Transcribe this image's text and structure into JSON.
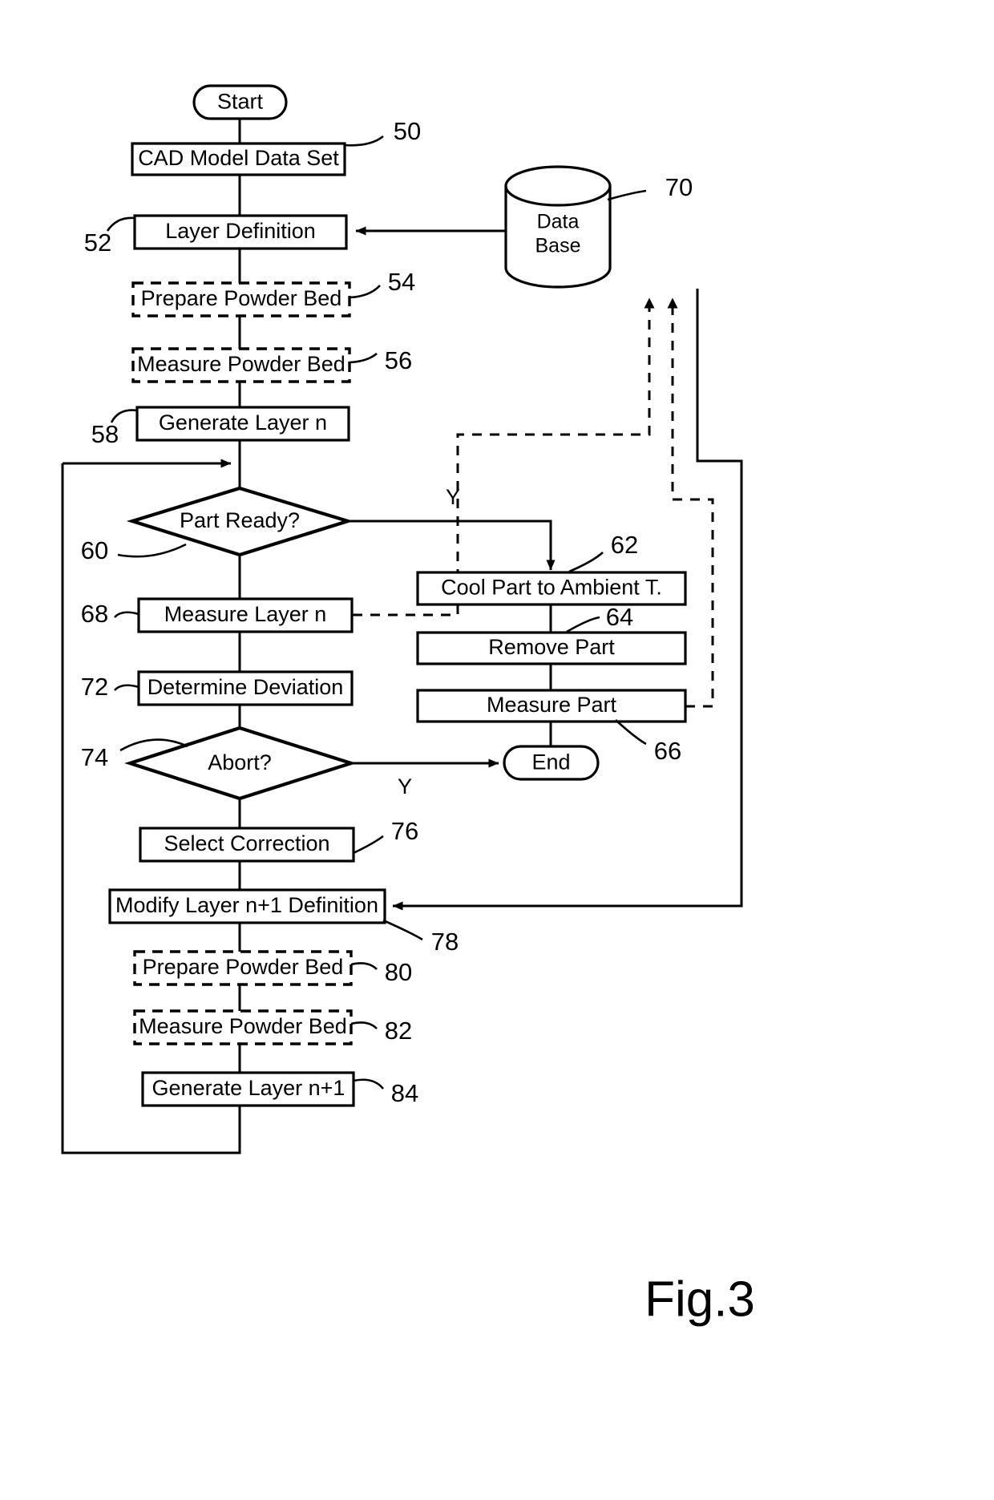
{
  "figure": {
    "caption": "Fig.3",
    "nodes": {
      "start": {
        "label": "Start",
        "type": "terminal"
      },
      "cad": {
        "label": "CAD Model Data Set",
        "type": "process",
        "ref": "50"
      },
      "layer_def": {
        "label": "Layer Definition",
        "type": "process",
        "ref": "52"
      },
      "prepare_bed_1": {
        "label": "Prepare Powder Bed",
        "type": "optional-process",
        "ref": "54"
      },
      "measure_bed_1": {
        "label": "Measure Powder Bed",
        "type": "optional-process",
        "ref": "56"
      },
      "generate_n": {
        "label": "Generate Layer n",
        "type": "process",
        "ref": "58"
      },
      "part_ready": {
        "label": "Part Ready?",
        "type": "decision",
        "ref": "60"
      },
      "cool_part": {
        "label": "Cool Part to Ambient T.",
        "type": "process",
        "ref": "62"
      },
      "remove_part": {
        "label": "Remove Part",
        "type": "process",
        "ref": "64"
      },
      "measure_part": {
        "label": "Measure Part",
        "type": "process",
        "ref": "66"
      },
      "measure_n": {
        "label": "Measure Layer n",
        "type": "process",
        "ref": "68"
      },
      "database": {
        "label_line1": "Data",
        "label_line2": "Base",
        "type": "database",
        "ref": "70"
      },
      "determine_dev": {
        "label": "Determine Deviation",
        "type": "process",
        "ref": "72"
      },
      "abort": {
        "label": "Abort?",
        "type": "decision",
        "ref": "74"
      },
      "end": {
        "label": "End",
        "type": "terminal"
      },
      "select_corr": {
        "label": "Select Correction",
        "type": "process",
        "ref": "76"
      },
      "modify_np1": {
        "label": "Modify Layer n+1 Definition",
        "type": "process",
        "ref": "78"
      },
      "prepare_bed_2": {
        "label": "Prepare Powder Bed",
        "type": "optional-process",
        "ref": "80"
      },
      "measure_bed_2": {
        "label": "Measure Powder Bed",
        "type": "optional-process",
        "ref": "82"
      },
      "generate_np1": {
        "label": "Generate Layer n+1",
        "type": "process",
        "ref": "84"
      }
    },
    "branch_labels": {
      "part_ready_yes": "Y",
      "abort_yes": "Y"
    },
    "colors": {
      "ink": "#000000",
      "paper": "#ffffff"
    }
  }
}
